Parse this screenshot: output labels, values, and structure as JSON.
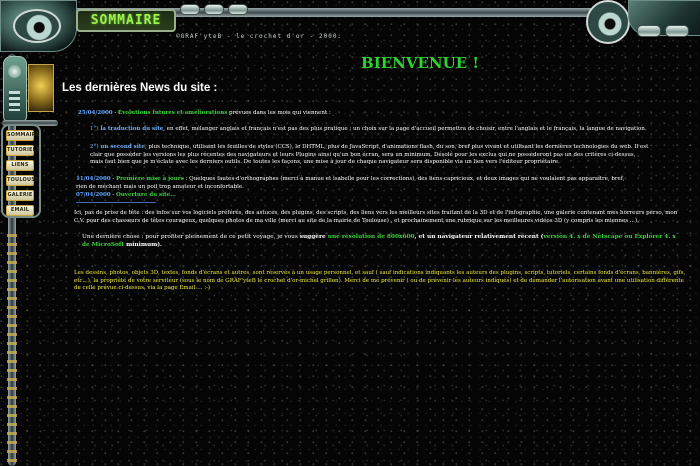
{
  "header": {
    "sommaire_label": "SOMMAIRE",
    "copyright_line": "©GRAF'yteB - le crochet d'or - 2000."
  },
  "sidebar": {
    "menu": [
      {
        "label": "SOMMAIRE"
      },
      {
        "label": "TUTORIELS"
      },
      {
        "label": "LIENS"
      },
      {
        "label": "TOULOUSE"
      },
      {
        "label": "GALERIE"
      },
      {
        "label": "EMAIL"
      }
    ]
  },
  "main": {
    "welcome": "BIENVENUE !",
    "news_title": "Les dernières News du site :",
    "news1": {
      "date": "25/04/2000",
      "sep": " - ",
      "title": "Évolutions futures et améliorations",
      "rest": " prévues dans les mois qui viennent :"
    },
    "bullet1": {
      "marker": "1°)",
      "title": " la traduction du site",
      "text": ", en effet, mélanger anglais et français n'est pas des plus pratique : un choix sur la page d'accueil permettra de choisir, entre l'anglais et le français, la langue de navigation."
    },
    "bullet2": {
      "marker": "2°)",
      "title": " un second site",
      "text": ", plus technique, utilisant les feuilles de styles (CCS), le DHTML, plus de JavaScript, d'animations flash, du son, bref plus vivant et utilisant les dernières technologies du web. Il est clair que posséder les versions les plus récentes des navigateurs et leurs Plugins ainsi qu'un bon écran, sera un minimum. Désolé pour les exclus qui ne possèderont pas un des critères ci-dessus, mais faut bien que je m'éclate avec les derniers outils. De toutes les façons, une mise à jour de chaque navigateur sera disponible via un lien vers l'éditeur propriétaire."
    },
    "news2": {
      "date": "11/04/2000",
      "sep": " - ",
      "title": "Première mise à jours",
      "rest": " : Quelques fautes d'orthographes (merci à manue et isabelle pour les corrections), des liens capricieux, et deux images qui ne voulaient pas apparaître, bref, rien de méchant mais un poil trop amateur et inconfortable."
    },
    "news3": {
      "date": "07/04/2000",
      "sep": " - ",
      "title": "Ouverture du site..."
    },
    "intro": "Ici, pas de prise de tête : des infos sur vos logiciels préférés, des astuces, des plugins, des scripts, des liens vers les meilleurs sites traitant de la 3D et de l'infographie, une galerie contenant mes horreurs perso, mon C.V. pour des chasseurs de têtes courageux, quelques photos de ma ville (merci au site de la mairie de Toulouse) , et prochainement une rubrique sur les meilleures vidéos 3D (y compris les miennes ...).",
    "advice": {
      "before": "Une dernière chose : pour profiter pleinement de ce petit voyage, je vous ",
      "suggere": "suggère",
      "mid": " une résolution de 800x600",
      "mid2": ", et un navigateur relativement récent (",
      "version": "version 4. x de Netscape ou Explorer 4. x de MicroSoft",
      "end": " minimum)."
    },
    "legal": "Les dessins, photos, objets 3D, textes, fonds d'écrans et autres, sont réservés à un usage personnel, et sauf ( sauf indications indiquants les auteurs des plugins, scripts, tutoriels, certains fonds d'écrans, bannières, gifs, etc...), la propriété de votre serviteur (sous le nom de GRAF'yteB le crochet d'or-michel grillon). Merci de me prévenir ( ou de prévenir les auteurs indiqués) et de demander l'autorisation avant une utilisation différente de celle prévue ci-dessus, via la page Email ... :-)"
  },
  "colors": {
    "welcome": "#2cd32c",
    "date": "#5fa6ff",
    "highlight": "#38d23a",
    "legal": "#f0ec40"
  }
}
